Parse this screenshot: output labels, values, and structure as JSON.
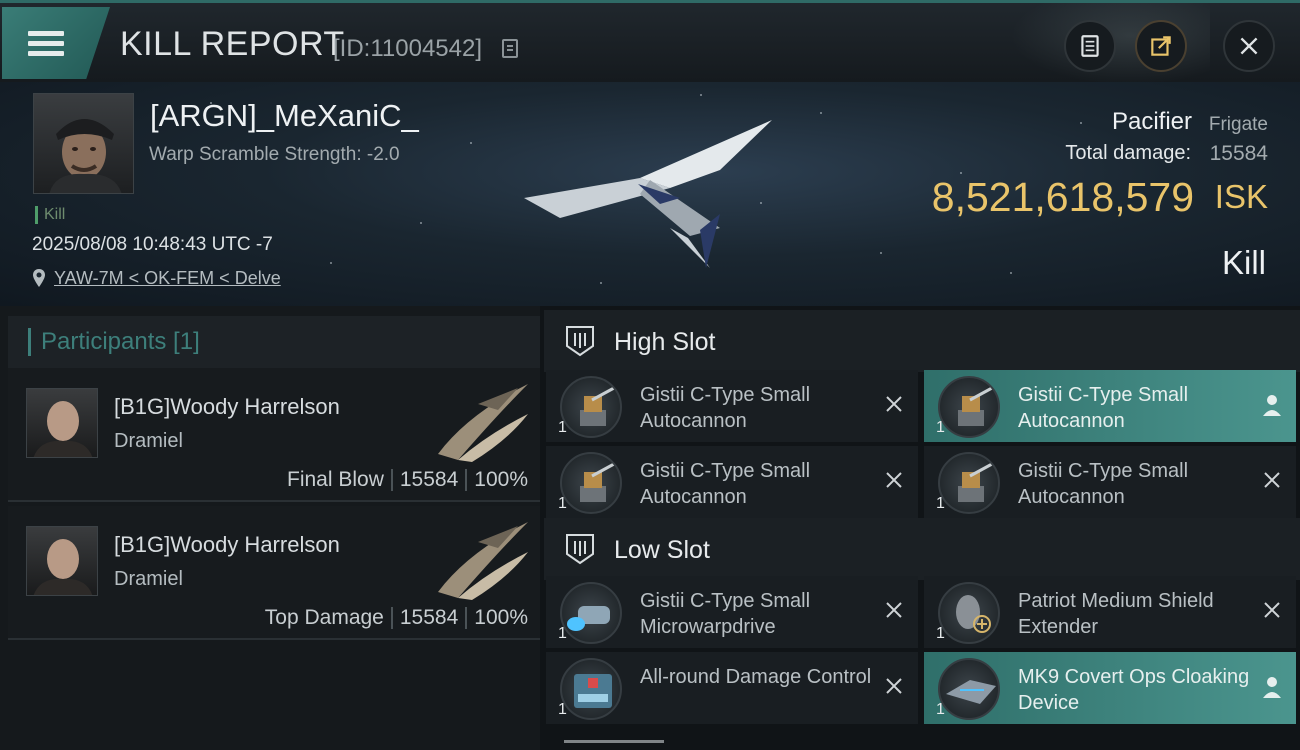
{
  "header": {
    "title": "KILL REPORT",
    "report_id": "[ID:11004542]",
    "menu_icon": "hamburger-icon",
    "buttons": [
      "clipboard-icon",
      "share-icon",
      "close-icon"
    ]
  },
  "victim": {
    "name": "[ARGN]_MeXaniC_",
    "warp_scramble": "Warp Scramble Strength: -2.0",
    "tag": "Kill",
    "timestamp": "2025/08/08 10:48:43 UTC -7",
    "location": "YAW-7M < OK-FEM < Delve",
    "ship_name": "Pacifier",
    "ship_class": "Frigate",
    "total_damage_label": "Total damage:",
    "total_damage": "15584",
    "isk_value": "8,521,618,579",
    "isk_unit": "ISK",
    "outcome": "Kill"
  },
  "participants": {
    "header": "Participants [1]",
    "rows": [
      {
        "name": "[B1G]Woody Harrelson",
        "ship": "Dramiel",
        "role": "Final Blow",
        "damage": "15584",
        "percent": "100%"
      },
      {
        "name": "[B1G]Woody Harrelson",
        "ship": "Dramiel",
        "role": "Top Damage",
        "damage": "15584",
        "percent": "100%"
      }
    ]
  },
  "fitting": {
    "high_slot_label": "High Slot",
    "low_slot_label": "Low Slot",
    "high": [
      {
        "qty": "1",
        "name": "Gistii C-Type Small Autocannon",
        "state": "destroyed"
      },
      {
        "qty": "1",
        "name": "Gistii C-Type Small Autocannon",
        "state": "dropped"
      },
      {
        "qty": "1",
        "name": "Gistii C-Type Small Autocannon",
        "state": "destroyed"
      },
      {
        "qty": "1",
        "name": "Gistii C-Type Small Autocannon",
        "state": "destroyed"
      }
    ],
    "low": [
      {
        "qty": "1",
        "name": "Gistii C-Type Small Microwarpdrive",
        "state": "destroyed"
      },
      {
        "qty": "1",
        "name": "Patriot Medium Shield Extender",
        "state": "destroyed"
      },
      {
        "qty": "1",
        "name": "All-round Damage Control",
        "state": "destroyed"
      },
      {
        "qty": "1",
        "name": "MK9 Covert Ops Cloaking Device",
        "state": "dropped"
      }
    ]
  },
  "colors": {
    "accent": "#3d7f7b",
    "isk": "#e9c46a",
    "dropped": "#4b958e"
  }
}
